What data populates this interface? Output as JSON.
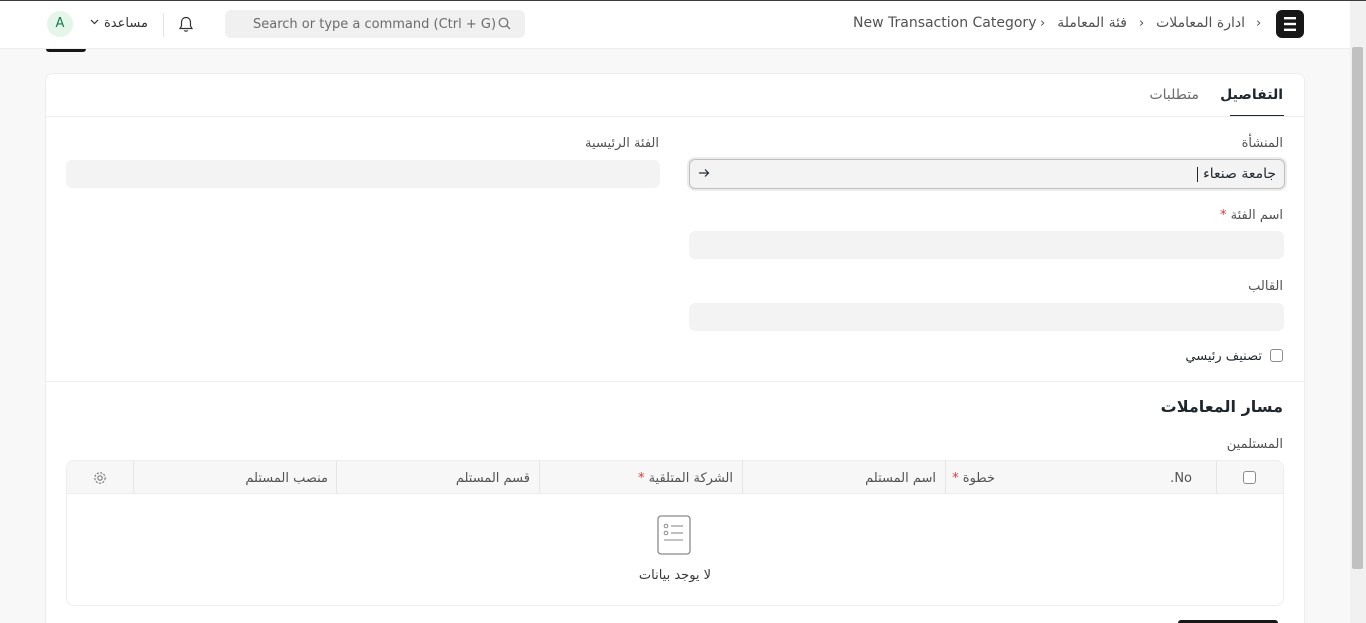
{
  "navbar": {
    "breadcrumbs": [
      "ادارة المعاملات",
      "فئة المعاملة",
      "New Transaction Category"
    ],
    "search_placeholder": "Search or type a command (Ctrl + G)",
    "help_label": "مساعدة",
    "avatar_initial": "A"
  },
  "tabs": [
    {
      "label": "التفاصيل",
      "active": true
    },
    {
      "label": "متطلبات",
      "active": false
    }
  ],
  "form": {
    "company_label": "المنشأة",
    "company_value": "جامعة صنعاء",
    "parent_category_label": "الفئة الرئيسية",
    "parent_category_value": "",
    "category_name_label": "اسم الفئة",
    "category_name_value": "",
    "template_label": "القالب",
    "template_value": "",
    "is_group_label": "تصنيف رئيسي",
    "is_group_checked": false,
    "required_mark": "*"
  },
  "workflow_section": {
    "title": "مسار المعاملات",
    "recipients_label": "المستلمين",
    "columns": [
      "No.",
      "خطوة",
      "اسم المستلم",
      "الشركة المتلقية",
      "قسم المستلم",
      "منصب المستلم"
    ],
    "required_columns": [
      "خطوة",
      "الشركة المتلقية"
    ],
    "empty_text": "لا يوجد بيانات"
  },
  "colors": {
    "accent": "#171717",
    "required": "#e03636",
    "field_bg": "#f3f3f3"
  }
}
